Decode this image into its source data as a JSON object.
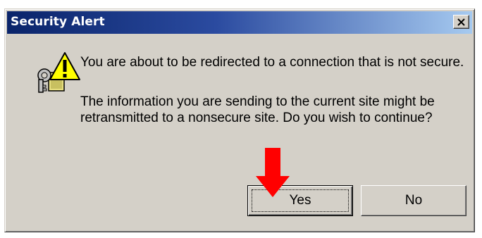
{
  "window": {
    "title": "Security Alert",
    "close_icon": "close-icon"
  },
  "dialog": {
    "icon": "security-lock-warning-icon",
    "message_line1": "You are about to be redirected to a connection that is not secure.",
    "message_line2": "The information you are sending to the current site might be retransmitted to a nonsecure site. Do you wish to continue?"
  },
  "buttons": {
    "yes_label": "Yes",
    "no_label": "No",
    "default": "yes"
  },
  "annotation": {
    "arrow_icon": "red-down-arrow-icon",
    "arrow_color": "#ff0000"
  },
  "colors": {
    "titlebar_start": "#0a246a",
    "titlebar_end": "#a6caf0",
    "dialog_bg": "#d4d0c8"
  }
}
